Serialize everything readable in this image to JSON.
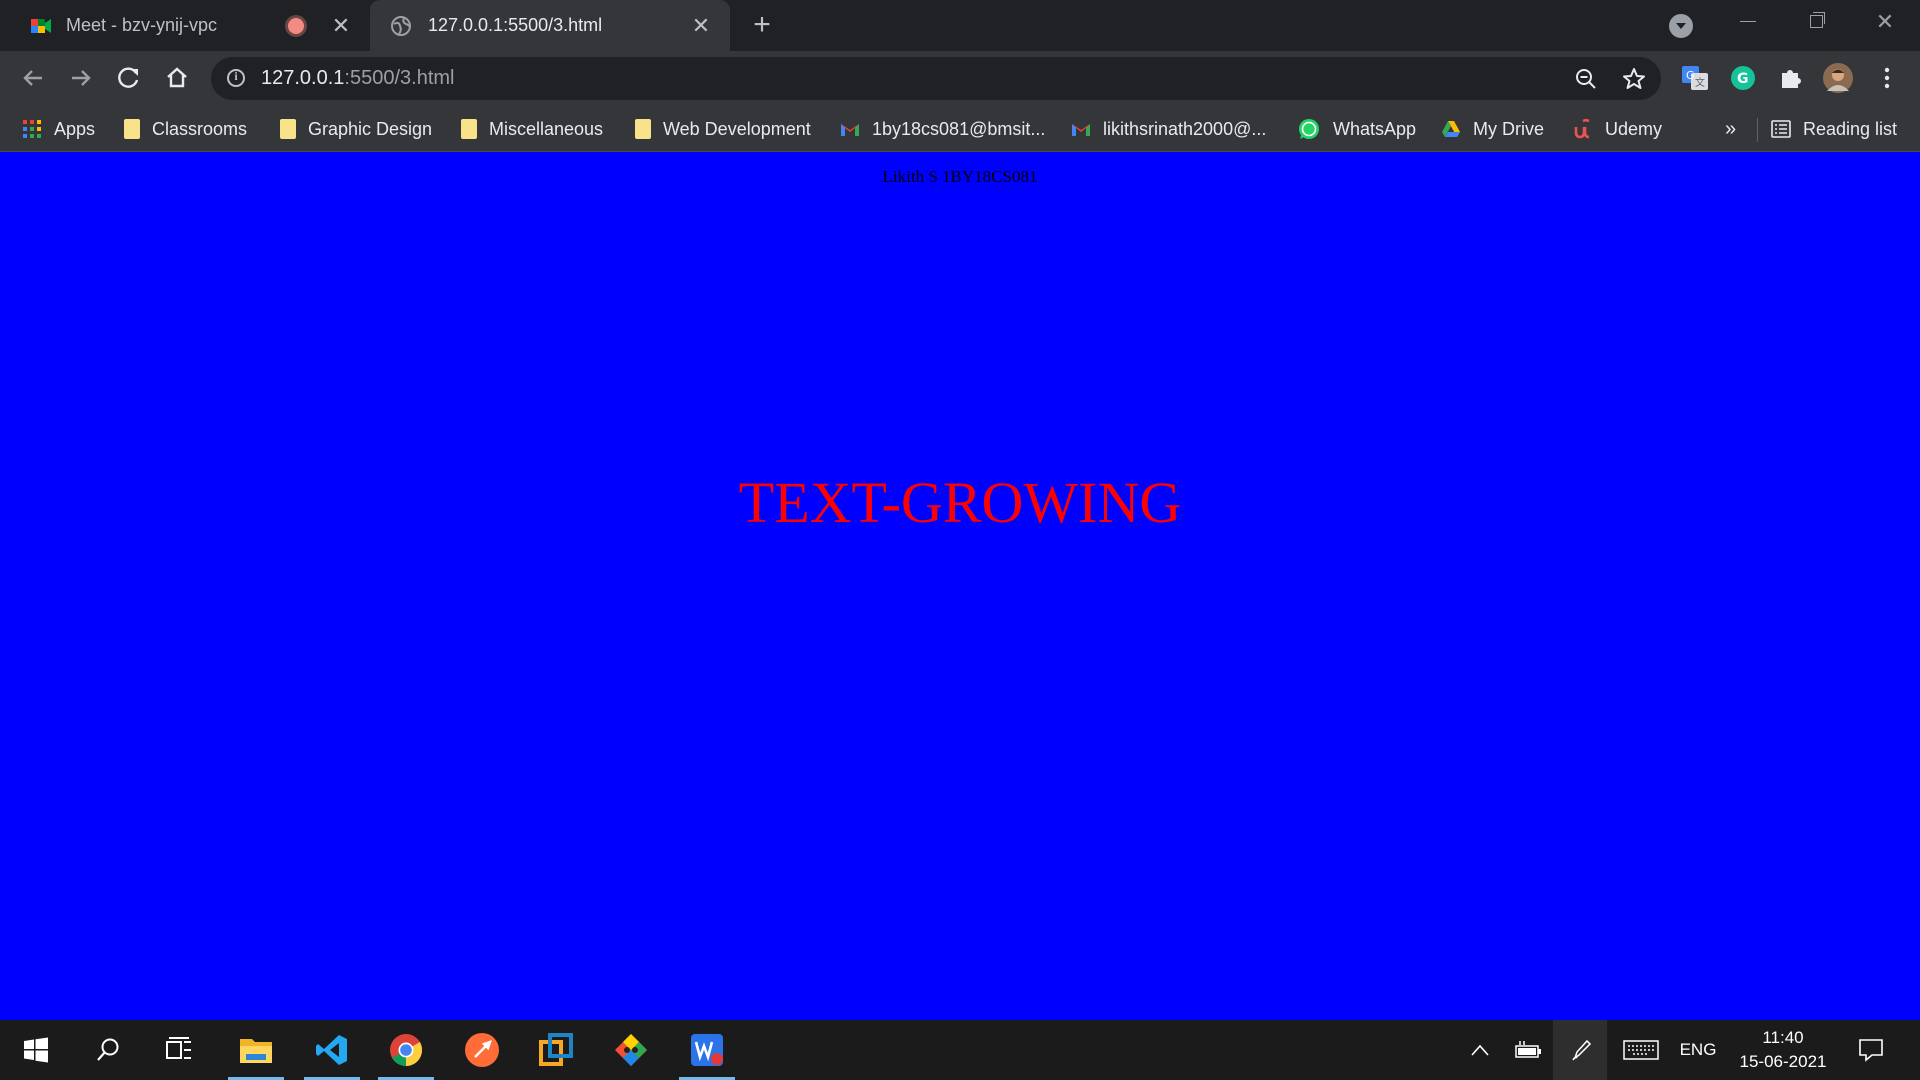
{
  "browser": {
    "tabs": [
      {
        "title": "Meet - bzv-ynij-vpc",
        "state": "inactive",
        "icon": "google-meet-icon",
        "recording": true
      },
      {
        "title": "127.0.0.1:5500/3.html",
        "state": "active",
        "icon": "globe-icon"
      }
    ],
    "address_bar": {
      "host": "127.0.0.1",
      "path": ":5500/3.html"
    },
    "bookmarks": [
      {
        "label": "Apps",
        "icon": "apps-grid-icon"
      },
      {
        "label": "Classrooms",
        "icon": "folder-icon"
      },
      {
        "label": "Graphic Design",
        "icon": "folder-icon"
      },
      {
        "label": "Miscellaneous",
        "icon": "folder-icon"
      },
      {
        "label": "Web Development",
        "icon": "folder-icon"
      },
      {
        "label": "1by18cs081@bmsit...",
        "icon": "gmail-icon"
      },
      {
        "label": "likithsrinath2000@...",
        "icon": "gmail-icon"
      },
      {
        "label": "WhatsApp",
        "icon": "whatsapp-icon"
      },
      {
        "label": "My Drive",
        "icon": "google-drive-icon"
      },
      {
        "label": "Udemy",
        "icon": "udemy-icon"
      }
    ],
    "overflow_label": "»",
    "reading_list": "Reading list"
  },
  "page": {
    "background": "#0000ff",
    "author_line": "Likith S 1BY18CS081",
    "heading": "TEXT-GROWING",
    "heading_color": "#ff0000"
  },
  "taskbar": {
    "apps": [
      "windows-start-icon",
      "search-icon",
      "task-view-icon",
      "file-explorer-icon",
      "vscode-icon",
      "chrome-icon",
      "postman-icon",
      "virtualbox-icon",
      "git-icon",
      "wps-office-icon"
    ],
    "language": "ENG",
    "time": "11:40",
    "date": "15-06-2021"
  },
  "colors": {
    "chrome_dark": "#202124",
    "chrome_toolbar": "#35363a",
    "taskbar": "#1b1b1b"
  }
}
